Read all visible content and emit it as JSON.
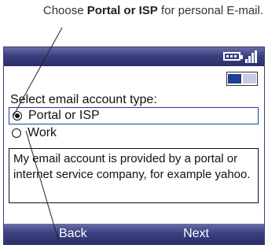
{
  "callout": {
    "pre": "Choose ",
    "bold": "Portal or ISP",
    "post": " for personal E-mail."
  },
  "prompt": "Select email account type:",
  "options": [
    {
      "label": "Portal or ISP",
      "selected": true
    },
    {
      "label": "Work",
      "selected": false
    }
  ],
  "description": "My email account is provided by a portal or internet service company, for example yahoo.",
  "softkeys": {
    "left": "Back",
    "right": "Next"
  }
}
